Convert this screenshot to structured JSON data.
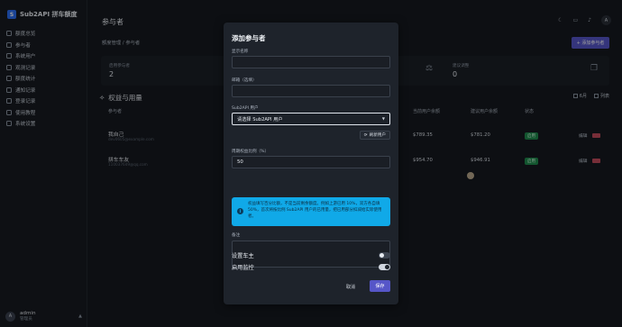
{
  "sidebar": {
    "brand": "Sub2API 拼车额度",
    "items": [
      {
        "label": "额度总览"
      },
      {
        "label": "参与者"
      },
      {
        "label": "系统用户"
      },
      {
        "label": "观测记录"
      },
      {
        "label": "额度统计"
      },
      {
        "label": "通知记录"
      },
      {
        "label": "登录记录"
      },
      {
        "label": "使用教程"
      },
      {
        "label": "系统设置"
      }
    ],
    "user": {
      "avatar": "A",
      "name": "admin",
      "role": "管理员"
    }
  },
  "header": {
    "title": "参与者",
    "breadcrumb": "额度管理 / 参与者",
    "avatar": "A",
    "add_button": "+ 添加参与者"
  },
  "stats": {
    "total_label": "启用参与者",
    "total_value": "2",
    "pending_label": "建议调整",
    "pending_value": "0"
  },
  "section": {
    "title": "权益与用量",
    "monthly": "6月",
    "table_view": "列表"
  },
  "table": {
    "headers": [
      "参与者",
      "当前用户余额",
      "建议用户余额",
      "状态"
    ],
    "rows": [
      {
        "name": "我自己",
        "email": "dev0605@example.com",
        "current": "$789.35",
        "suggest": "$781.20",
        "status": "启用",
        "edit": "编辑"
      },
      {
        "name": "拼车车友",
        "email": "110037649@qq.com",
        "current": "$954.70",
        "suggest": "$946.91",
        "status": "启用",
        "edit": "编辑"
      }
    ]
  },
  "modal": {
    "title": "添加参与者",
    "display_name_label": "显示名称",
    "display_name_value": "",
    "email_label": "邮箱（选填）",
    "email_value": "",
    "sub2api_label": "Sub2API 用户",
    "sub2api_select": "请选择 Sub2API 用户",
    "refresh_button": "刷新用户",
    "ratio_label": "周期权益比例（%）",
    "ratio_value": "50",
    "info_text": "权益填写百分比额，不是当前剩余额度。例如上游已用 10%，双方各自填 50%，首次将按比例 Sub2API 用户的已用量，把已用部分扣减给实际使用者。",
    "note_label": "备注",
    "note_value": "",
    "owner_label": "设置车主",
    "owner_on": false,
    "monitor_label": "启用监控",
    "monitor_on": true,
    "cancel": "取消",
    "save": "保存"
  }
}
